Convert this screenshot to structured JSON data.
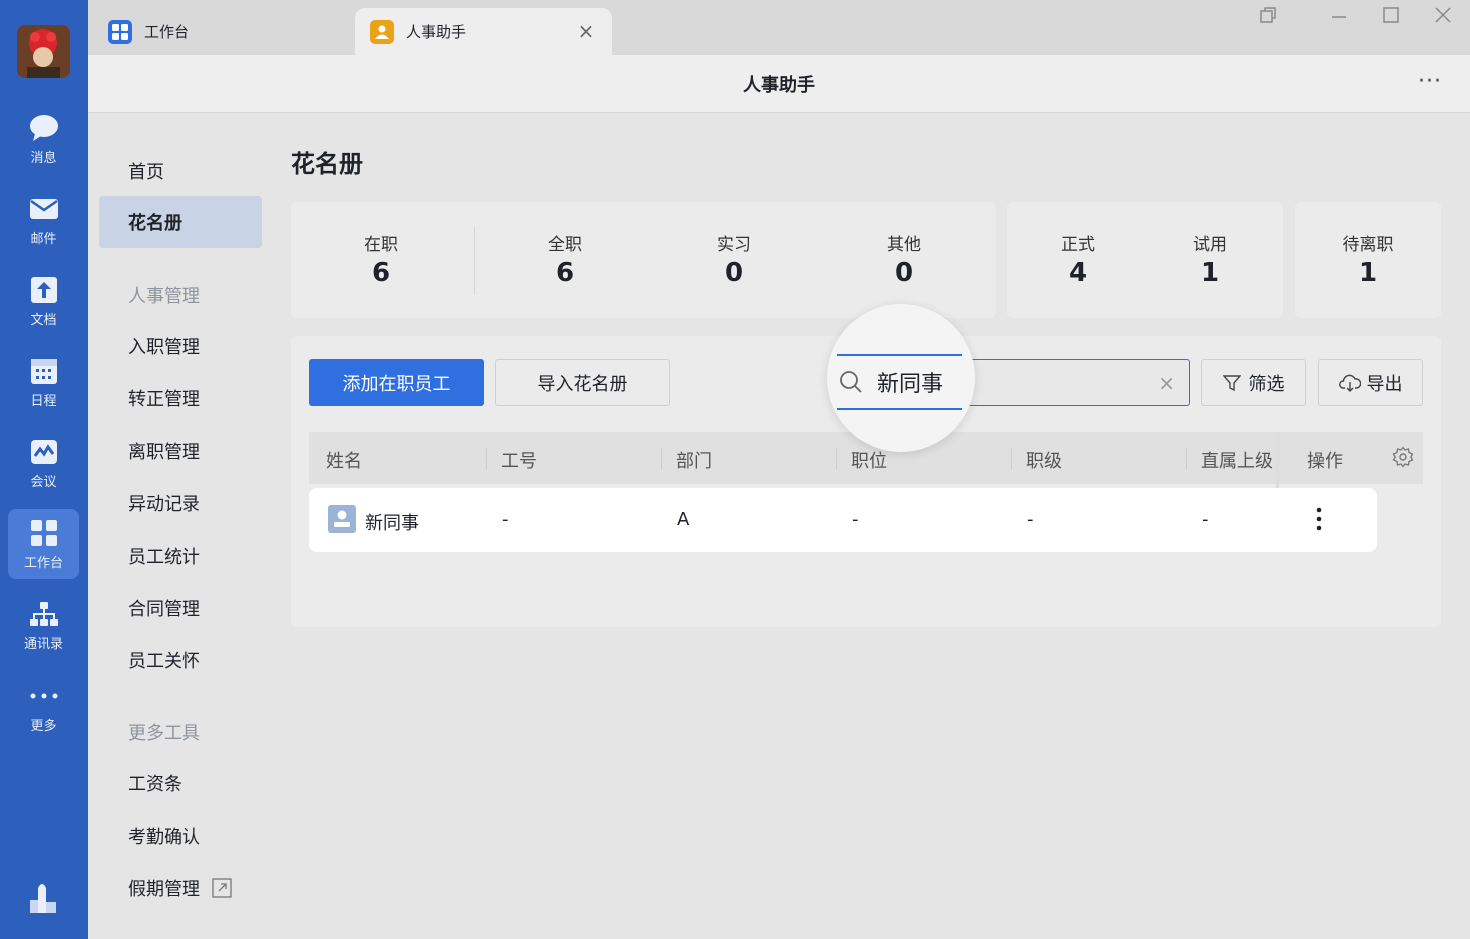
{
  "rail": {
    "items": [
      {
        "label": "消息",
        "icon": "chat-bubble-icon"
      },
      {
        "label": "邮件",
        "icon": "mail-icon"
      },
      {
        "label": "文档",
        "icon": "document-icon"
      },
      {
        "label": "日程",
        "icon": "calendar-icon"
      },
      {
        "label": "会议",
        "icon": "meeting-icon"
      },
      {
        "label": "工作台",
        "icon": "workbench-icon",
        "active": true
      },
      {
        "label": "通讯录",
        "icon": "contacts-icon"
      },
      {
        "label": "更多",
        "icon": "more-dots-icon"
      }
    ]
  },
  "tabs": [
    {
      "label": "工作台",
      "icon": "workbench-icon"
    },
    {
      "label": "人事助手",
      "icon": "hr-assistant-icon",
      "active": true
    }
  ],
  "header": {
    "title": "人事助手",
    "more": "···"
  },
  "subnav": {
    "home": "首页",
    "roster": "花名册",
    "group1": "人事管理",
    "group1_items": [
      "入职管理",
      "转正管理",
      "离职管理",
      "异动记录",
      "员工统计",
      "合同管理",
      "员工关怀"
    ],
    "group2": "更多工具",
    "group2_items": [
      "工资条",
      "考勤确认",
      "假期管理"
    ]
  },
  "page": {
    "title": "花名册"
  },
  "stats": {
    "on_job": {
      "label": "在职",
      "value": "6"
    },
    "full_time": {
      "label": "全职",
      "value": "6"
    },
    "intern": {
      "label": "实习",
      "value": "0"
    },
    "other": {
      "label": "其他",
      "value": "0"
    },
    "formal": {
      "label": "正式",
      "value": "4"
    },
    "probation": {
      "label": "试用",
      "value": "1"
    },
    "pending_leave": {
      "label": "待离职",
      "value": "1"
    }
  },
  "toolbar": {
    "add_label": "添加在职员工",
    "import_label": "导入花名册",
    "search_value": "新同事",
    "filter_label": "筛选",
    "export_label": "导出"
  },
  "table": {
    "columns": [
      "姓名",
      "工号",
      "部门",
      "职位",
      "职级",
      "直属上级",
      "操作"
    ],
    "rows": [
      {
        "name": "新同事",
        "id": "-",
        "dept": "A",
        "position": "-",
        "level": "-",
        "manager": "-"
      }
    ]
  },
  "colors": {
    "rail": "#2d5fbd",
    "primary": "#2f6fe0",
    "tab_icon_hr": "#e8a317"
  }
}
